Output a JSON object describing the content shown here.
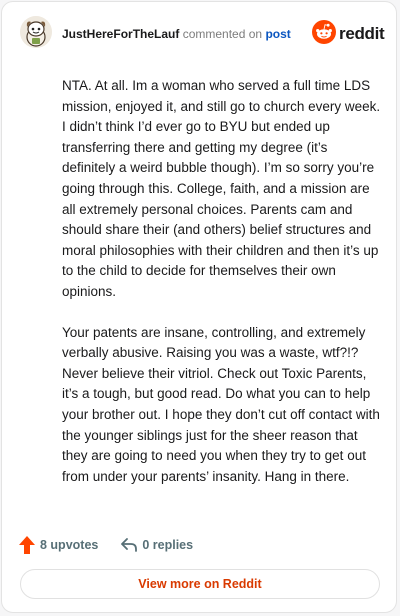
{
  "header": {
    "username": "JustHereForTheLauf",
    "action_text": "commented on",
    "post_link": "post",
    "brand_word": "reddit",
    "brand_icon": "reddit-alien-icon",
    "avatar_icon": "snoo-avatar-icon"
  },
  "comment": {
    "paragraphs": [
      "NTA. At all. Im a woman who served a full time LDS mission, enjoyed it, and still go to church every week. I didn’t think I’d ever go to BYU but ended up transferring there and getting my degree (it’s definitely a weird bubble though). I’m so sorry you’re going through this. College, faith, and a mission are all extremely personal choices. Parents cam and should share their (and others) belief structures and moral philosophies with their children and then it’s up to the child to decide for themselves their own opinions.",
      "Your patents are insane, controlling, and extremely verbally abusive. Raising you was a waste, wtf?!? Never believe their vitriol. Check out Toxic Parents, it’s a tough, but good read. Do what you can to help your brother out. I hope they don’t cut off contact with the younger siblings just for the sheer reason that they are going to need you when they try to get out from under your parents’ insanity. Hang in there."
    ]
  },
  "actions": {
    "upvotes_label": "8 upvotes",
    "replies_label": "0 replies",
    "upvote_icon": "upvote-arrow-icon",
    "reply_icon": "reply-arrow-icon"
  },
  "footer": {
    "view_more_label": "View more on Reddit"
  },
  "colors": {
    "brand_orange": "#ff4500",
    "link_blue": "#0b56c0",
    "view_more_text": "#d93a00",
    "action_gray": "#576f76"
  }
}
